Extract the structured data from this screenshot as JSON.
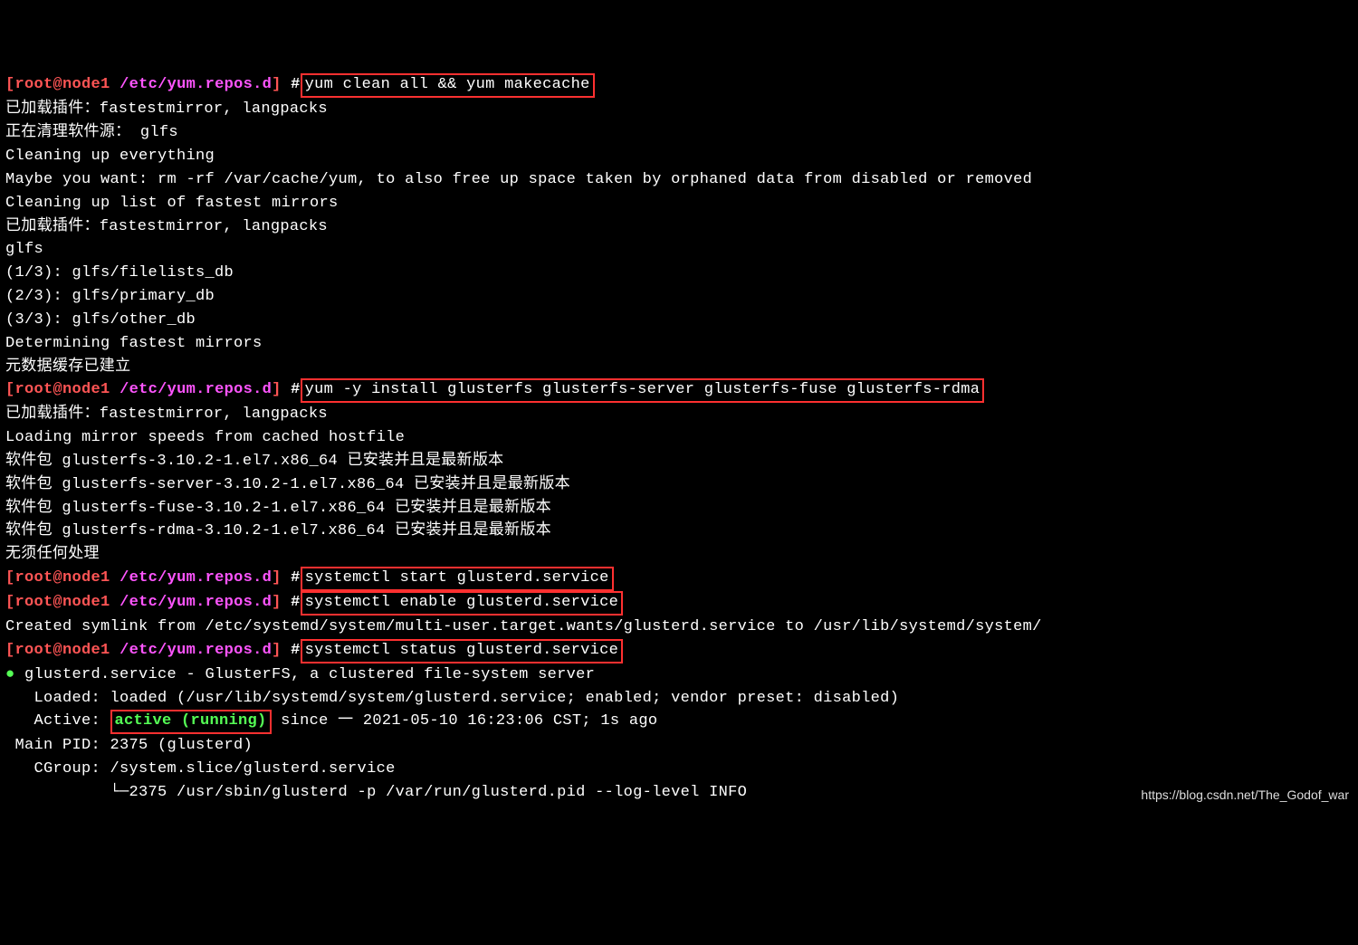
{
  "prompt1": {
    "open": "[",
    "user": "root@node1",
    "sep": " ",
    "path": "/etc/yum.repos.d",
    "close": "]",
    "hash": " #",
    "cmd": "yum clean all && yum makecache"
  },
  "out1": {
    "l1": "已加载插件：fastestmirror, langpacks",
    "l2": "正在清理软件源： glfs",
    "l3": "Cleaning up everything",
    "l4": "Maybe you want: rm -rf /var/cache/yum, to also free up space taken by orphaned data from disabled or removed",
    "l5": "Cleaning up list of fastest mirrors",
    "l6": "已加载插件：fastestmirror, langpacks",
    "l7": "glfs",
    "l8": "(1/3): glfs/filelists_db",
    "l9": "(2/3): glfs/primary_db",
    "l10": "(3/3): glfs/other_db",
    "l11": "Determining fastest mirrors",
    "l12": "元数据缓存已建立"
  },
  "prompt2": {
    "cmd": "yum -y install glusterfs glusterfs-server glusterfs-fuse glusterfs-rdma"
  },
  "out2": {
    "l1": "已加载插件：fastestmirror, langpacks",
    "l2": "Loading mirror speeds from cached hostfile",
    "l3": "软件包 glusterfs-3.10.2-1.el7.x86_64 已安装并且是最新版本",
    "l4": "软件包 glusterfs-server-3.10.2-1.el7.x86_64 已安装并且是最新版本",
    "l5": "软件包 glusterfs-fuse-3.10.2-1.el7.x86_64 已安装并且是最新版本",
    "l6": "软件包 glusterfs-rdma-3.10.2-1.el7.x86_64 已安装并且是最新版本",
    "l7": "无须任何处理"
  },
  "prompt3": {
    "cmd": "systemctl start glusterd.service"
  },
  "prompt4": {
    "cmd": "systemctl enable glusterd.service"
  },
  "out3": {
    "l1": "Created symlink from /etc/systemd/system/multi-user.target.wants/glusterd.service to /usr/lib/systemd/system/"
  },
  "prompt5": {
    "cmd": "systemctl status glusterd.service"
  },
  "status": {
    "bullet": "●",
    "l1": " glusterd.service - GlusterFS, a clustered file-system server",
    "l2": "   Loaded: loaded (/usr/lib/systemd/system/glusterd.service; enabled; vendor preset: disabled)",
    "l3a": "   Active: ",
    "l3b": "active (running)",
    "l3c": " since 一 2021-05-10 16:23:06 CST; 1s ago",
    "l4": " Main PID: 2375 (glusterd)",
    "l5": "   CGroup: /system.slice/glusterd.service",
    "l6": "           └─2375 /usr/sbin/glusterd -p /var/run/glusterd.pid --log-level INFO"
  },
  "watermark": "https://blog.csdn.net/The_Godof_war"
}
